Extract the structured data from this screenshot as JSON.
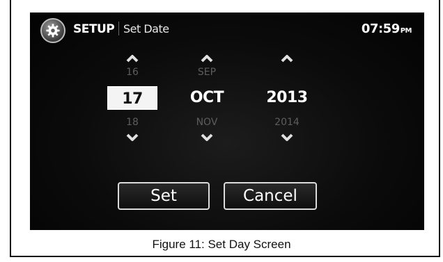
{
  "header": {
    "icon": "gear-icon",
    "section": "SETUP",
    "page": "Set Date",
    "time": "07:59",
    "ampm": "PM"
  },
  "date_picker": {
    "day": {
      "prev": "16",
      "current": "17",
      "next": "18",
      "selected": true
    },
    "month": {
      "prev": "SEP",
      "current": "OCT",
      "next": "NOV",
      "selected": false
    },
    "year": {
      "prev": "",
      "current": "2013",
      "next": "2014",
      "selected": false
    }
  },
  "buttons": {
    "set": "Set",
    "cancel": "Cancel"
  },
  "caption": "Figure 11: Set Day Screen"
}
